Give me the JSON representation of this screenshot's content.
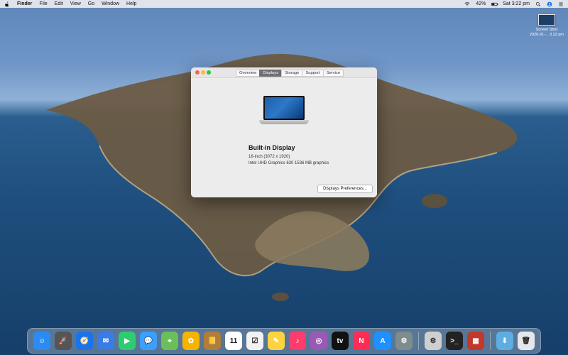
{
  "menubar": {
    "apple_icon": "apple-icon",
    "items": [
      "Finder",
      "File",
      "Edit",
      "View",
      "Go",
      "Window",
      "Help"
    ],
    "status": {
      "battery": "42%",
      "time": "Sat 3:22 pm"
    }
  },
  "desktop": {
    "screenshot_label_1": "Screen Shot",
    "screenshot_label_2": "2020-01-... 3.22 pm"
  },
  "about_window": {
    "tabs": [
      {
        "label": "Overview",
        "active": false
      },
      {
        "label": "Displays",
        "active": true
      },
      {
        "label": "Storage",
        "active": false
      },
      {
        "label": "Support",
        "active": false
      },
      {
        "label": "Service",
        "active": false
      }
    ],
    "display_title": "Built-in Display",
    "display_size": "16-inch (3072 x 1920)",
    "graphics": "Intel UHD Graphics 630 1536 MB graphics",
    "prefs_button": "Displays Preferences..."
  },
  "dock": {
    "items": [
      {
        "name": "finder-icon",
        "color": "#2a8cf2",
        "glyph": "☺"
      },
      {
        "name": "launchpad-icon",
        "color": "#555",
        "glyph": "🚀"
      },
      {
        "name": "safari-icon",
        "color": "#1a73e8",
        "glyph": "🧭"
      },
      {
        "name": "mail-icon",
        "color": "#3b7be6",
        "glyph": "✉"
      },
      {
        "name": "facetime-icon",
        "color": "#2ecc71",
        "glyph": "▶"
      },
      {
        "name": "messages-icon",
        "color": "#3aa0ff",
        "glyph": "💬"
      },
      {
        "name": "maps-icon",
        "color": "#6bbf59",
        "glyph": "⌖"
      },
      {
        "name": "photos-icon",
        "color": "#f4b400",
        "glyph": "✿"
      },
      {
        "name": "contacts-icon",
        "color": "#b07d3a",
        "glyph": "📒"
      },
      {
        "name": "calendar-icon",
        "color": "#ffffff",
        "glyph": "11"
      },
      {
        "name": "reminders-icon",
        "color": "#f2f2f2",
        "glyph": "☑"
      },
      {
        "name": "notes-icon",
        "color": "#ffd23f",
        "glyph": "✎"
      },
      {
        "name": "music-icon",
        "color": "#ff3b6b",
        "glyph": "♪"
      },
      {
        "name": "podcasts-icon",
        "color": "#9b59b6",
        "glyph": "◎"
      },
      {
        "name": "tv-icon",
        "color": "#111111",
        "glyph": "tv"
      },
      {
        "name": "news-icon",
        "color": "#ff2d55",
        "glyph": "N"
      },
      {
        "name": "app-store-icon",
        "color": "#1e90ff",
        "glyph": "A"
      },
      {
        "name": "system-preferences-icon",
        "color": "#7f8c8d",
        "glyph": "⚙"
      },
      {
        "name": "separator",
        "sep": true
      },
      {
        "name": "utility-icon",
        "color": "#cfcfcf",
        "glyph": "⚙"
      },
      {
        "name": "terminal-icon",
        "color": "#222",
        "glyph": ">_"
      },
      {
        "name": "photo-booth-icon",
        "color": "#c0392b",
        "glyph": "▦"
      },
      {
        "name": "separator-2",
        "sep": true
      },
      {
        "name": "downloads-icon",
        "color": "#5dade2",
        "glyph": "⬇"
      },
      {
        "name": "trash-icon",
        "color": "#e5e7ea",
        "glyph": "🗑"
      }
    ]
  }
}
